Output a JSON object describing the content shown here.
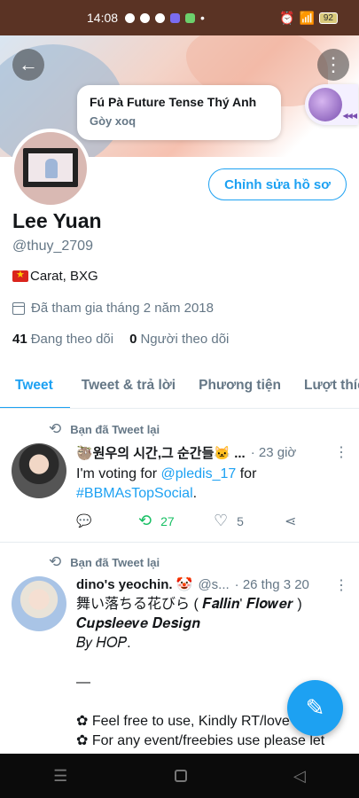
{
  "status_bar": {
    "time": "14:08",
    "battery": "92"
  },
  "notification": {
    "title": "Fú Pà Future Tense Thý Anh",
    "subtitle": "Gòy xoq"
  },
  "profile": {
    "edit_button": "Chỉnh sửa hồ sơ",
    "name": "Lee Yuan",
    "handle": "@thuy_2709",
    "bio": "Carat, BXG",
    "joined": "Đã tham gia tháng 2 năm 2018",
    "following_count": "41",
    "following_label": "Đang theo dõi",
    "followers_count": "0",
    "followers_label": "Người theo dõi"
  },
  "tabs": [
    "Tweet",
    "Tweet & trả lời",
    "Phương tiện",
    "Lượt thích"
  ],
  "tweets": [
    {
      "retweet_label": "Bạn đã Tweet lại",
      "author": "🦥원우의 시간,그 순간들🐱 ...",
      "meta": "· 23 giờ",
      "text_before": "I'm voting for ",
      "mention": "@pledis_17",
      "text_after": " for",
      "hashtag": "#BBMAsTopSocial",
      "hashtag_suffix": ".",
      "retweets": "27",
      "likes": "5"
    },
    {
      "retweet_label": "Bạn đã Tweet lại",
      "author": "dino's yeochin. 🤡",
      "handle": "@s...",
      "meta": "· 26 thg 3 20",
      "line1": "舞い落ちる花びら ( 𝑭𝒂𝒍𝒍𝒊𝒏' 𝑭𝒍𝒐𝒘𝒆𝒓 )",
      "line2": "𝑪𝒖𝒑𝒔𝒍𝒆𝒆𝒗𝒆 𝑫𝒆𝒔𝒊𝒈𝒏",
      "line3": "𝐵𝑦 𝐻𝑂𝑃.",
      "line4": "—",
      "line5": "✿ Feel free to use, Kindly RT/love",
      "line6": "✿ For any event/freebies use please let"
    }
  ],
  "icons": {
    "back": "arrow-left-icon",
    "more": "more-vertical-icon",
    "compose": "compose-tweet-icon"
  },
  "colors": {
    "accent": "#1da1f2",
    "retweet_green": "#17bf63",
    "status_bar": "#5a3324"
  }
}
